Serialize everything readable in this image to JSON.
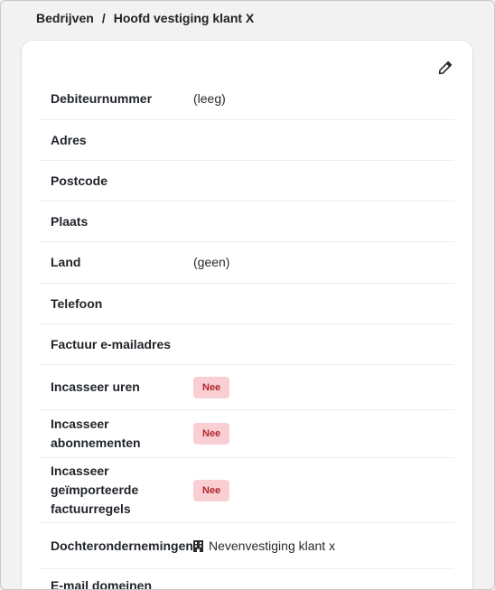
{
  "breadcrumb": {
    "parent": "Bedrijven",
    "separator": "/",
    "current": "Hoofd vestiging klant X"
  },
  "card": {
    "edit_icon": "pencil-icon",
    "rows": [
      {
        "label": "Debiteurnummer",
        "value": "(leeg)"
      },
      {
        "label": "Adres",
        "value": ""
      },
      {
        "label": "Postcode",
        "value": ""
      },
      {
        "label": "Plaats",
        "value": ""
      },
      {
        "label": "Land",
        "value": "(geen)"
      },
      {
        "label": "Telefoon",
        "value": ""
      },
      {
        "label": "Factuur e-mailadres",
        "value": ""
      },
      {
        "label": "Incasseer uren",
        "badge": "Nee"
      },
      {
        "label": "Incasseer abonnementen",
        "badge": "Nee"
      },
      {
        "label": "Incasseer geïmporteerde factuurregels",
        "badge": "Nee"
      },
      {
        "label": "Dochterondernemingen",
        "value": "Nevenvestiging klant x",
        "icon": "building-icon"
      },
      {
        "label": "E-mail domeinen",
        "value": ""
      }
    ]
  },
  "colors": {
    "badge_bg": "#f9cfd3",
    "badge_text": "#b3262e",
    "page_bg": "#f2f2f3"
  }
}
